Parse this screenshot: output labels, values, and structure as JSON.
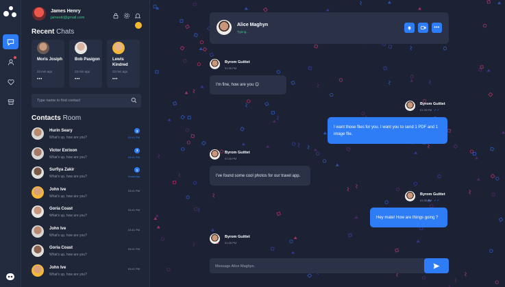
{
  "user": {
    "name": "James Henry",
    "email": "jameskl@gmail.com"
  },
  "sidebar": {
    "recent_title_bold": "Recent",
    "recent_title_rest": " Chats",
    "contacts_title_bold": "Contacts",
    "contacts_title_rest": " Room",
    "search_placeholder": "Type name to find contact"
  },
  "recent_chats": [
    {
      "name": "Moris Josiph",
      "time": "23 min ago",
      "more": "•••"
    },
    {
      "name": "Bob Pasigon",
      "time": "23 min ago",
      "more": "•••"
    },
    {
      "name": "Lewis Kindred",
      "time": "23 min ago",
      "more": "•••"
    }
  ],
  "contacts": [
    {
      "name": "Hurin Seary",
      "message": "What's up, how are you?",
      "badge": "3",
      "time": "03:41 PM"
    },
    {
      "name": "Victor Exrixon",
      "message": "What's up, how are you?",
      "badge": "3",
      "time": "03:41 PM"
    },
    {
      "name": "Surfiya Zakir",
      "message": "What's up, how are you?",
      "badge": "1",
      "time": "Yesterday"
    },
    {
      "name": "John Ive",
      "message": "What's up, how are you?",
      "badge": "",
      "time": "03:41 PM"
    },
    {
      "name": "Goria Coast",
      "message": "What's up, how are you?",
      "badge": "",
      "time": "03:41 PM"
    },
    {
      "name": "John Ive",
      "message": "What's up, how are you?",
      "badge": "",
      "time": "03:41 PM"
    },
    {
      "name": "Goria Coast",
      "message": "What's up, how are you?",
      "badge": "",
      "time": "03:41 PM"
    },
    {
      "name": "John Ive",
      "message": "What's up, how are you?",
      "badge": "",
      "time": "03:41 PM"
    }
  ],
  "chat": {
    "contact_name": "Alice Maghyn",
    "status": "Typing...",
    "header_buttons": [
      "bell-icon",
      "video-icon",
      "more-icon"
    ],
    "composer_placeholder": "Message Alice Maghyn.",
    "messages": [
      {
        "sender": "Byrom Guittet",
        "time": "01:35 PM",
        "text": "I'm fine, how are you 😊",
        "direction": "in"
      },
      {
        "sender": "Byrom Guittet",
        "time": "01:35 PM",
        "text": "I want those files for you. I want you to send 1 PDF and 1 image file.",
        "direction": "out"
      },
      {
        "sender": "Byrom Guittet",
        "time": "01:35 PM",
        "text": "I've found some cool photos for our travel app.",
        "direction": "in"
      },
      {
        "sender": "Byrom Guittet",
        "time": "01:35 PM",
        "text": "Hey mate! How are things going ?",
        "direction": "out"
      },
      {
        "sender": "Byrom Guittet",
        "time": "01:35 PM",
        "text": "",
        "direction": "in"
      }
    ]
  },
  "colors": {
    "accent": "#2e7cf6",
    "online": "#3fc58a",
    "background": "#1c2233",
    "card": "#2b3247"
  }
}
